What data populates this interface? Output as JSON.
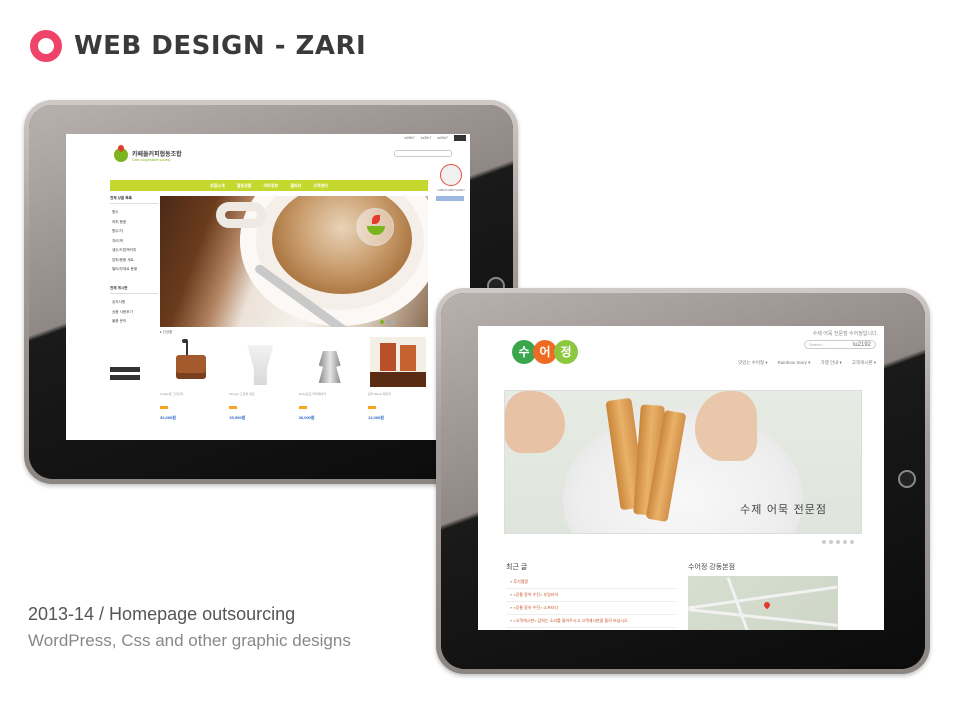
{
  "header": {
    "title": "WEB DESIGN - ZARI",
    "accent": "#f0436a"
  },
  "caption": {
    "line1": "2013-14 / Homepage outsourcing",
    "line2": "WordPress,  Css and other graphic designs"
  },
  "site1": {
    "logo_name": "카페들커피협동조합",
    "logo_sub": "Cafe cooperative society",
    "nav": [
      "조합소개",
      "협동상품",
      "커피정보",
      "갤러리",
      "고객센터"
    ],
    "sidebar_heading_1": "전체 상품 목록",
    "sidebar_items_1": [
      "원두",
      "커피 용품",
      "원두/차",
      "차/티백",
      "생두/드립백커피",
      "덤퍼/용품 세트",
      "필터/부재료 용품"
    ],
    "sidebar_heading_2": "전체 게시판",
    "sidebar_items_2": [
      "공지사항",
      "상품 사용후기",
      "물품 문의"
    ],
    "section_label": "▸ 신상품",
    "products": [
      {
        "name": "Coffee밀 그라인더",
        "price": "32,000원"
      },
      {
        "name": "Dripper 드립퍼 세트",
        "price": "25,000원"
      },
      {
        "name": "Moka포트 커피메이커",
        "price": "36,000원"
      },
      {
        "name": "원두 Blend 패키지",
        "price": "12,000원"
      }
    ]
  },
  "site2": {
    "logo_chars": [
      "수",
      "어",
      "정"
    ],
    "logo_colors": [
      "#3aa54a",
      "#ee6b24",
      "#8dc63f"
    ],
    "top_note": "수제 어묵 전문점 수어정입니다.",
    "search_placeholder": "Search...",
    "nav": [
      "맛있는 수어정 ▾",
      "Rainbow Story ▾",
      "가맹 안내 ▾",
      "고객게시판 ▾"
    ],
    "hero_text": "수제 어묵 전문점",
    "recent_heading": "최근 글",
    "recent_posts": [
      "» 후기탭알",
      "» <강통 몽어 우진> 부일라이",
      "» <강통 몽어 우진> 소프타다",
      "» <고객게시판> 감하는 소리를 들어주시고 고객게시판을 올려 보십시오."
    ],
    "map_heading": "수어정 강동본점"
  }
}
